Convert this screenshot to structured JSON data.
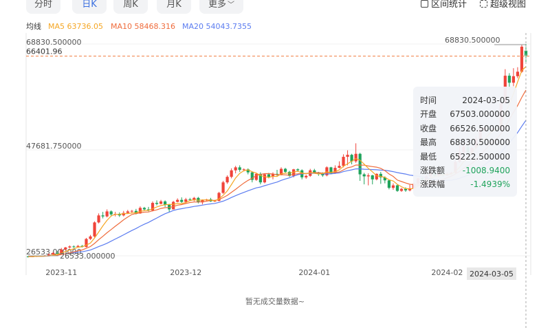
{
  "tabs": [
    {
      "label": "分时",
      "active": false
    },
    {
      "label": "日K",
      "active": true
    },
    {
      "label": "周K",
      "active": false
    },
    {
      "label": "月K",
      "active": false
    },
    {
      "label": "更多",
      "active": false
    }
  ],
  "tools": {
    "range_stats": "区间统计",
    "super_view": "超级视图"
  },
  "legend": {
    "title": "均线",
    "ma5": {
      "label": "MA5",
      "value": "63736.05",
      "color": "#f5a623"
    },
    "ma10": {
      "label": "MA10",
      "value": "58468.316",
      "color": "#ef6b3b"
    },
    "ma20": {
      "label": "MA20",
      "value": "54043.7355",
      "color": "#5b7cf0"
    }
  },
  "colors": {
    "up": "#f0443a",
    "down": "#1fa35b",
    "ma5": "#f5a623",
    "ma10": "#ef6b3b",
    "ma20": "#5b7cf0"
  },
  "chart_data": {
    "type": "candlestick",
    "y_range": [
      26533,
      68830.5
    ],
    "y_labels": [
      "68830.500000",
      "47681.750000",
      "26533.000000"
    ],
    "max_label": "68830.500000",
    "min_label": "26533.000000",
    "current_price": "66401.96",
    "x_ticks": [
      "2023-11",
      "2023-12",
      "2024-01",
      "2024-02"
    ],
    "crosshair_date": "2024-03-05",
    "candles": [
      [
        26400,
        26350,
        26540,
        26200
      ],
      [
        26350,
        26400,
        26550,
        26250
      ],
      [
        26400,
        26500,
        26560,
        26300
      ],
      [
        26500,
        26450,
        26600,
        26350
      ],
      [
        26450,
        26600,
        26700,
        26400
      ],
      [
        26600,
        26800,
        27000,
        26500
      ],
      [
        26800,
        27100,
        27300,
        26700
      ],
      [
        27100,
        27000,
        27500,
        26900
      ],
      [
        27000,
        27800,
        28100,
        26900
      ],
      [
        27800,
        28200,
        28300,
        27600
      ],
      [
        28200,
        28400,
        28600,
        28000
      ],
      [
        28400,
        28300,
        28600,
        28100
      ],
      [
        28300,
        28500,
        28700,
        28200
      ],
      [
        28500,
        28300,
        28700,
        28200
      ],
      [
        28300,
        29900,
        30100,
        28200
      ],
      [
        29900,
        30400,
        30700,
        29700
      ],
      [
        30400,
        33200,
        33400,
        30200
      ],
      [
        33200,
        34600,
        35000,
        33000
      ],
      [
        34600,
        34400,
        35300,
        34000
      ],
      [
        34400,
        35400,
        35800,
        34200
      ],
      [
        35400,
        34800,
        35600,
        34400
      ],
      [
        34800,
        34900,
        35300,
        34400
      ],
      [
        34900,
        34600,
        35200,
        34300
      ],
      [
        34600,
        35100,
        35500,
        34400
      ],
      [
        35100,
        35400,
        35700,
        35000
      ],
      [
        35400,
        35500,
        35700,
        35000
      ],
      [
        35500,
        35000,
        35900,
        34800
      ],
      [
        35000,
        36100,
        36400,
        34900
      ],
      [
        36100,
        35800,
        36300,
        35600
      ],
      [
        35800,
        35600,
        36300,
        35400
      ],
      [
        35600,
        37100,
        37400,
        35400
      ],
      [
        37100,
        36900,
        37600,
        36600
      ],
      [
        36900,
        37400,
        37700,
        36800
      ],
      [
        37400,
        36700,
        37600,
        36300
      ],
      [
        36700,
        35800,
        36900,
        35300
      ],
      [
        35800,
        37300,
        37500,
        35800
      ],
      [
        37300,
        37700,
        38000,
        37200
      ],
      [
        37700,
        37300,
        38200,
        37100
      ],
      [
        37300,
        37800,
        38100,
        37000
      ],
      [
        37800,
        37700,
        38100,
        37500
      ],
      [
        37700,
        38100,
        38300,
        37400
      ],
      [
        38100,
        37200,
        38300,
        37000
      ],
      [
        37200,
        37700,
        37800,
        36800
      ],
      [
        37700,
        37800,
        37900,
        37500
      ],
      [
        37800,
        37400,
        38100,
        37300
      ],
      [
        37400,
        37500,
        37600,
        37300
      ],
      [
        37500,
        39100,
        39300,
        37400
      ],
      [
        39100,
        41200,
        41500,
        38900
      ],
      [
        41200,
        42300,
        42600,
        40900
      ],
      [
        42300,
        43600,
        44000,
        42000
      ],
      [
        43600,
        44200,
        44500,
        43000
      ],
      [
        44200,
        43700,
        44600,
        43300
      ],
      [
        43700,
        43800,
        44000,
        43400
      ],
      [
        43800,
        43200,
        44000,
        42800
      ],
      [
        43200,
        41700,
        43400,
        41200
      ],
      [
        41700,
        42900,
        43100,
        41500
      ],
      [
        42900,
        41200,
        43200,
        40800
      ],
      [
        41200,
        42800,
        43000,
        41000
      ],
      [
        42800,
        42300,
        43100,
        42000
      ],
      [
        42300,
        42900,
        43200,
        41800
      ],
      [
        42900,
        42700,
        43700,
        42500
      ],
      [
        42700,
        43900,
        44200,
        42600
      ],
      [
        43900,
        43300,
        44100,
        43000
      ],
      [
        43300,
        42500,
        43500,
        42300
      ],
      [
        42500,
        43800,
        43900,
        42200
      ],
      [
        43800,
        43600,
        44000,
        43300
      ],
      [
        43600,
        42200,
        43800,
        41800
      ],
      [
        42200,
        42500,
        42700,
        41900
      ],
      [
        42500,
        43600,
        43900,
        42300
      ],
      [
        43600,
        43200,
        43900,
        43000
      ],
      [
        43200,
        42900,
        43300,
        42500
      ],
      [
        42900,
        42600,
        43200,
        42300
      ],
      [
        42600,
        44200,
        44400,
        42400
      ],
      [
        44200,
        43000,
        44300,
        42800
      ],
      [
        43000,
        44100,
        44600,
        42900
      ],
      [
        44100,
        44500,
        45400,
        44000
      ],
      [
        44500,
        46300,
        46800,
        44200
      ],
      [
        46300,
        46700,
        47600,
        44600
      ],
      [
        46700,
        45400,
        46900,
        44800
      ],
      [
        45400,
        46900,
        49000,
        45100
      ],
      [
        46900,
        42800,
        47100,
        41500
      ],
      [
        42800,
        42400,
        43100,
        40800
      ],
      [
        42400,
        42600,
        43000,
        40600
      ],
      [
        42600,
        41800,
        42700,
        40800
      ],
      [
        41800,
        42900,
        43000,
        41600
      ],
      [
        42900,
        42200,
        43300,
        40900
      ],
      [
        42200,
        41600,
        42400,
        41000
      ],
      [
        41600,
        40100,
        41700,
        39800
      ],
      [
        40100,
        40600,
        41000,
        39700
      ],
      [
        40600,
        39500,
        40800,
        39300
      ],
      [
        39500,
        39900,
        40100,
        39300
      ],
      [
        39900,
        39600,
        40200,
        39300
      ],
      [
        39600,
        40000,
        40700,
        39400
      ],
      [
        40000,
        40900,
        41100,
        39900
      ],
      [
        40900,
        42000,
        42100,
        40700
      ],
      [
        42000,
        41800,
        42200,
        41500
      ],
      [
        41800,
        42400,
        42700,
        41600
      ],
      [
        42400,
        43100,
        43700,
        42200
      ],
      [
        43100,
        42500,
        43500,
        42300
      ],
      [
        42500,
        43000,
        43300,
        42200
      ],
      [
        43000,
        42600,
        43400,
        42300
      ],
      [
        42600,
        42900,
        43200,
        42500
      ],
      [
        42900,
        43100,
        43300,
        42700
      ],
      [
        43100,
        45300,
        45600,
        43000
      ],
      [
        45300,
        47200,
        48600,
        45100
      ],
      [
        47200,
        48300,
        48800,
        47000
      ],
      [
        48300,
        47100,
        48600,
        46800
      ],
      [
        47100,
        48100,
        48300,
        46700
      ],
      [
        48100,
        49900,
        50400,
        47800
      ],
      [
        49900,
        51800,
        52000,
        49600
      ],
      [
        51800,
        52100,
        52300,
        51400
      ],
      [
        52100,
        51700,
        52500,
        51300
      ],
      [
        51700,
        51900,
        52100,
        51500
      ],
      [
        51900,
        51600,
        52300,
        51400
      ],
      [
        51600,
        57000,
        57500,
        51500
      ],
      [
        57000,
        62500,
        63800,
        56800
      ],
      [
        62500,
        61100,
        63000,
        59700
      ],
      [
        61100,
        62400,
        64000,
        60400
      ],
      [
        62400,
        63300,
        64200,
        62000
      ],
      [
        63300,
        68300,
        68700,
        63100
      ],
      [
        67500,
        66526.5,
        68830.5,
        65222.5
      ]
    ]
  },
  "tooltip": {
    "rows": [
      {
        "k": "时间",
        "v": "2024-03-05",
        "color": "#333333"
      },
      {
        "k": "开盘",
        "v": "67503.000000",
        "color": "#333333"
      },
      {
        "k": "收盘",
        "v": "66526.500000",
        "color": "#333333"
      },
      {
        "k": "最高",
        "v": "68830.500000",
        "color": "#333333"
      },
      {
        "k": "最低",
        "v": "65222.500000",
        "color": "#333333"
      },
      {
        "k": "涨跌额",
        "v": "-1008.9400",
        "color": "#1fa35b"
      },
      {
        "k": "涨跌幅",
        "v": "-1.4939%",
        "color": "#1fa35b"
      }
    ]
  },
  "volume": {
    "empty_text": "暂无成交量数据~"
  }
}
